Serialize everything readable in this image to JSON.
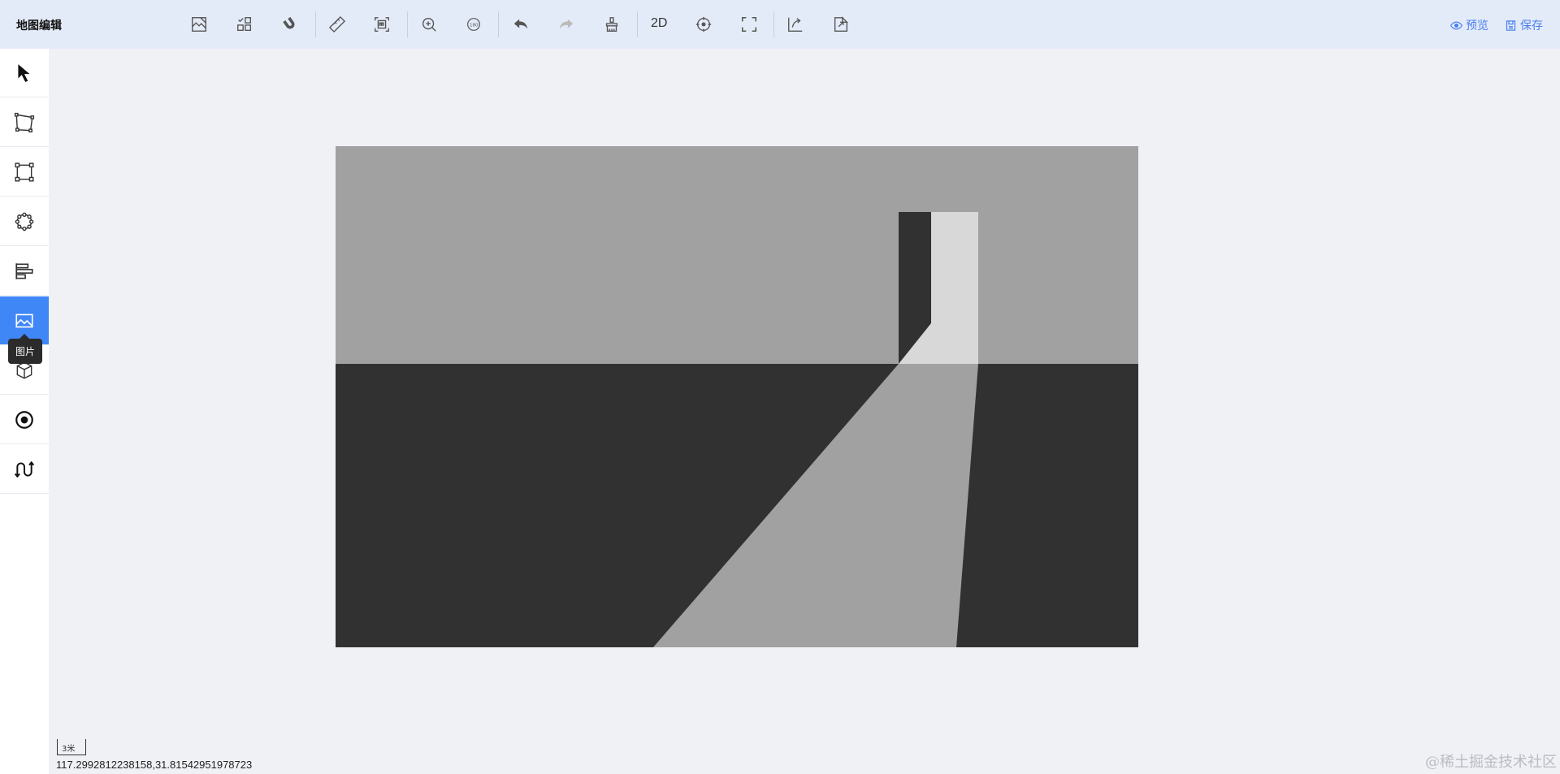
{
  "header": {
    "title": "地图编辑",
    "mode_label": "2D",
    "preview_label": "预览",
    "save_label": "保存"
  },
  "sidebar": {
    "tooltip": "图片",
    "accent_color": "#3f86f7"
  },
  "map": {
    "scale_label": "3米",
    "coordinates": "117.2992812238158,31.81542951978723"
  },
  "watermark": "@稀土掘金技术社区"
}
